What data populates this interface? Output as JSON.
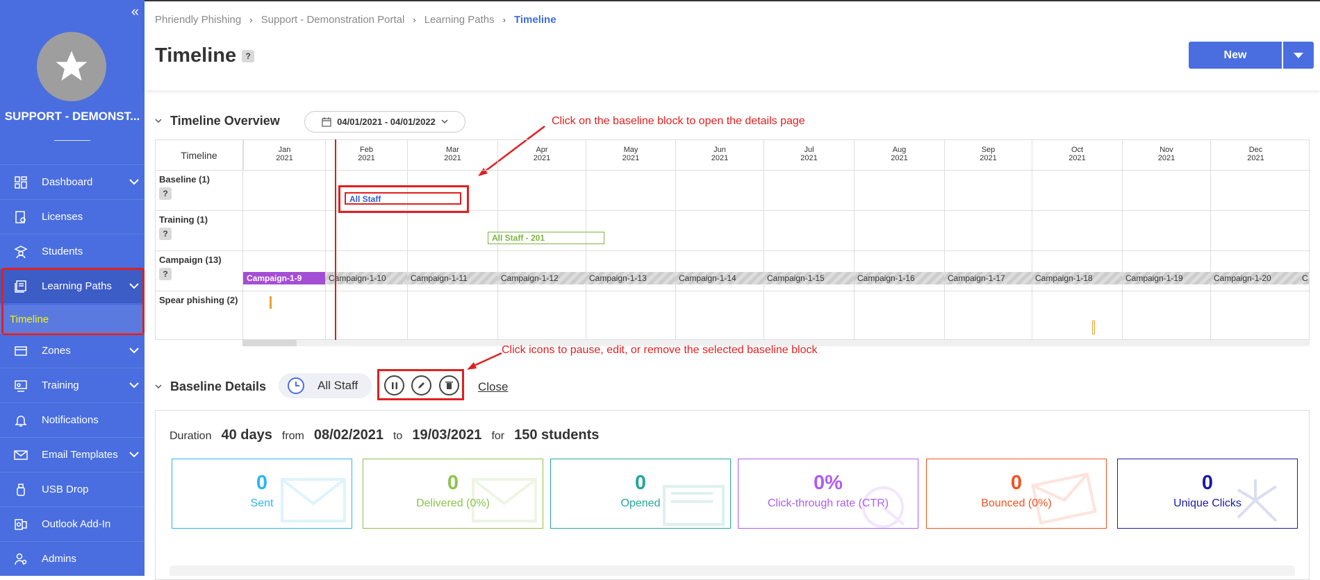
{
  "sidebar": {
    "org_name": "SUPPORT - DEMONST...",
    "items": [
      {
        "label": "Dashboard",
        "icon": "dashboard-icon",
        "chevron": true
      },
      {
        "label": "Licenses",
        "icon": "license-icon",
        "chevron": false
      },
      {
        "label": "Students",
        "icon": "student-icon",
        "chevron": false
      },
      {
        "label": "Learning Paths",
        "icon": "learning-paths-icon",
        "chevron": true
      },
      {
        "label": "Zones",
        "icon": "zones-icon",
        "chevron": true
      },
      {
        "label": "Training",
        "icon": "training-icon",
        "chevron": true
      },
      {
        "label": "Notifications",
        "icon": "bell-icon",
        "chevron": false
      },
      {
        "label": "Email Templates",
        "icon": "email-icon",
        "chevron": true
      },
      {
        "label": "USB Drop",
        "icon": "usb-icon",
        "chevron": false
      },
      {
        "label": "Outlook Add-In",
        "icon": "outlook-icon",
        "chevron": false
      },
      {
        "label": "Admins",
        "icon": "admins-icon",
        "chevron": false
      }
    ],
    "sub_item": "Timeline"
  },
  "breadcrumbs": [
    "Phriendly Phishing",
    "Support - Demonstration Portal",
    "Learning Paths",
    "Timeline"
  ],
  "page_title": "Timeline",
  "help_glyph": "?",
  "new_button": "New",
  "overview": {
    "title": "Timeline Overview",
    "date_range": "04/01/2021 - 04/01/2022",
    "corner_label": "Timeline",
    "months": [
      {
        "m": "Jan",
        "y": "2021"
      },
      {
        "m": "Feb",
        "y": "2021"
      },
      {
        "m": "Mar",
        "y": "2021"
      },
      {
        "m": "Apr",
        "y": "2021"
      },
      {
        "m": "May",
        "y": "2021"
      },
      {
        "m": "Jun",
        "y": "2021"
      },
      {
        "m": "Jul",
        "y": "2021"
      },
      {
        "m": "Aug",
        "y": "2021"
      },
      {
        "m": "Sep",
        "y": "2021"
      },
      {
        "m": "Oct",
        "y": "2021"
      },
      {
        "m": "Nov",
        "y": "2021"
      },
      {
        "m": "Dec",
        "y": "2021"
      }
    ],
    "rows": [
      "Baseline (1)",
      "Training (1)",
      "Campaign (13)",
      "Spear phishing (2)"
    ],
    "baseline_bar": "All Staff",
    "training_bar": "All Staff - 201",
    "campaigns": [
      "Campaign-1-9",
      "Campaign-1-10",
      "Campaign-1-11",
      "Campaign-1-12",
      "Campaign-1-13",
      "Campaign-1-14",
      "Campaign-1-15",
      "Campaign-1-16",
      "Campaign-1-17",
      "Campaign-1-18",
      "Campaign-1-19",
      "Campaign-1-20",
      "C"
    ]
  },
  "annotations": {
    "baseline": "Click on the baseline block to open the details page",
    "icons": "Click icons to pause, edit, or remove the selected baseline block"
  },
  "details": {
    "title": "Baseline Details",
    "selected": "All Staff",
    "close": "Close",
    "duration_label": "Duration",
    "duration": "40 days",
    "from_label": "from",
    "from": "08/02/2021",
    "to_label": "to",
    "to": "19/03/2021",
    "for_label": "for",
    "students": "150 students"
  },
  "stats": [
    {
      "value": "0",
      "label": "Sent",
      "color": "#29b6f6"
    },
    {
      "value": "0",
      "label": "Delivered (0%)",
      "color": "#8bc34a"
    },
    {
      "value": "0",
      "label": "Opened",
      "color": "#26a69a"
    },
    {
      "value": "0%",
      "label": "Click-through rate (CTR)",
      "color": "#b05cf0"
    },
    {
      "value": "0",
      "label": "Bounced (0%)",
      "color": "#f4511e"
    },
    {
      "value": "0",
      "label": "Unique Clicks",
      "color": "#1a1aa8"
    }
  ]
}
